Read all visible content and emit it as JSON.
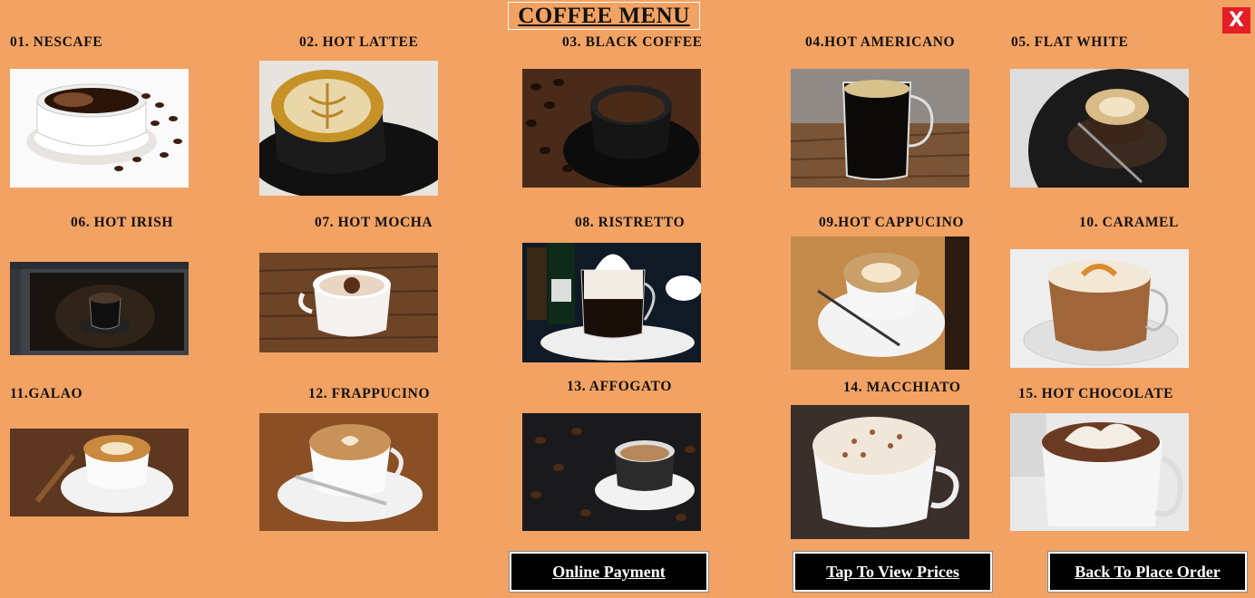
{
  "window": {
    "title": "COFFEE MENU",
    "close_label": "X"
  },
  "items": [
    {
      "label": "01. NESCAFE",
      "icon": "nescafe-coffee-cup-image"
    },
    {
      "label": "02. HOT LATTEE",
      "icon": "hot-latte-image"
    },
    {
      "label": "03. BLACK COFFEE",
      "icon": "black-coffee-image"
    },
    {
      "label": "04.HOT AMERICANO",
      "icon": "hot-americano-image"
    },
    {
      "label": "05. FLAT WHITE",
      "icon": "flat-white-image"
    },
    {
      "label": "06. HOT IRISH",
      "icon": "hot-irish-image"
    },
    {
      "label": "07. HOT MOCHA",
      "icon": "hot-mocha-image"
    },
    {
      "label": "08. RISTRETTO",
      "icon": "ristretto-image"
    },
    {
      "label": "09.HOT CAPPUCINO",
      "icon": "hot-cappucino-image"
    },
    {
      "label": "10. CARAMEL",
      "icon": "caramel-image"
    },
    {
      "label": "11.GALAO",
      "icon": "galao-image"
    },
    {
      "label": "12. FRAPPUCINO",
      "icon": "frappucino-image"
    },
    {
      "label": "13. AFFOGATO",
      "icon": "affogato-image"
    },
    {
      "label": "14. MACCHIATO",
      "icon": "macchiato-image"
    },
    {
      "label": "15. HOT CHOCOLATE",
      "icon": "hot-chocolate-image"
    }
  ],
  "buttons": {
    "online_payment": "Online Payment",
    "view_prices": "Tap To View Prices",
    "back_to_order": "Back To Place Order"
  },
  "colors": {
    "background": "#F2A263",
    "close": "#E41E26",
    "button_bg": "#000000"
  }
}
